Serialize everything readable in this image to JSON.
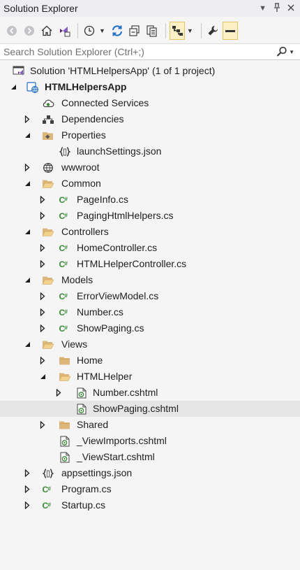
{
  "window": {
    "title": "Solution Explorer"
  },
  "search": {
    "placeholder": "Search Solution Explorer (Ctrl+;)"
  },
  "tree": [
    {
      "label": "Solution 'HTMLHelpersApp' (1 of 1 project)",
      "level": 0,
      "expander": "none",
      "icon": "solution-icon"
    },
    {
      "label": "HTMLHelpersApp",
      "level": 1,
      "expander": "expanded",
      "icon": "web-project-icon",
      "bold": true
    },
    {
      "label": "Connected Services",
      "level": 2,
      "expander": "none",
      "icon": "connected-services-icon"
    },
    {
      "label": "Dependencies",
      "level": 2,
      "expander": "collapsed",
      "icon": "dependencies-icon"
    },
    {
      "label": "Properties",
      "level": 2,
      "expander": "expanded",
      "icon": "properties-folder-icon"
    },
    {
      "label": "launchSettings.json",
      "level": 3,
      "expander": "none",
      "icon": "json-file-icon"
    },
    {
      "label": "wwwroot",
      "level": 2,
      "expander": "collapsed",
      "icon": "globe-icon"
    },
    {
      "label": "Common",
      "level": 2,
      "expander": "expanded",
      "icon": "folder-open-icon"
    },
    {
      "label": "PageInfo.cs",
      "level": 3,
      "expander": "collapsed",
      "icon": "csharp-file-icon"
    },
    {
      "label": "PagingHtmlHelpers.cs",
      "level": 3,
      "expander": "collapsed",
      "icon": "csharp-file-icon"
    },
    {
      "label": "Controllers",
      "level": 2,
      "expander": "expanded",
      "icon": "folder-open-icon"
    },
    {
      "label": "HomeController.cs",
      "level": 3,
      "expander": "collapsed",
      "icon": "csharp-file-icon"
    },
    {
      "label": "HTMLHelperController.cs",
      "level": 3,
      "expander": "collapsed",
      "icon": "csharp-file-icon"
    },
    {
      "label": "Models",
      "level": 2,
      "expander": "expanded",
      "icon": "folder-open-icon"
    },
    {
      "label": "ErrorViewModel.cs",
      "level": 3,
      "expander": "collapsed",
      "icon": "csharp-file-icon"
    },
    {
      "label": "Number.cs",
      "level": 3,
      "expander": "collapsed",
      "icon": "csharp-file-icon"
    },
    {
      "label": "ShowPaging.cs",
      "level": 3,
      "expander": "collapsed",
      "icon": "csharp-file-icon"
    },
    {
      "label": "Views",
      "level": 2,
      "expander": "expanded",
      "icon": "folder-open-icon"
    },
    {
      "label": "Home",
      "level": 3,
      "expander": "collapsed",
      "icon": "folder-icon"
    },
    {
      "label": "HTMLHelper",
      "level": 3,
      "expander": "expanded",
      "icon": "folder-open-icon"
    },
    {
      "label": "Number.cshtml",
      "level": 4,
      "expander": "collapsed",
      "icon": "cshtml-file-icon"
    },
    {
      "label": "ShowPaging.cshtml",
      "level": 4,
      "expander": "none",
      "icon": "cshtml-file-icon",
      "selected": true
    },
    {
      "label": "Shared",
      "level": 3,
      "expander": "collapsed",
      "icon": "folder-icon"
    },
    {
      "label": "_ViewImports.cshtml",
      "level": 3,
      "expander": "none",
      "icon": "cshtml-file-icon"
    },
    {
      "label": "_ViewStart.cshtml",
      "level": 3,
      "expander": "none",
      "icon": "cshtml-file-icon"
    },
    {
      "label": "appsettings.json",
      "level": 2,
      "expander": "collapsed",
      "icon": "json-file-icon"
    },
    {
      "label": "Program.cs",
      "level": 2,
      "expander": "collapsed",
      "icon": "csharp-file-icon"
    },
    {
      "label": "Startup.cs",
      "level": 2,
      "expander": "collapsed",
      "icon": "csharp-file-icon"
    }
  ],
  "colors": {
    "accent_blue": "#1e6fc8",
    "csharp_green": "#388a34",
    "folder_tan": "#dcb67a",
    "selection_bg": "#e6e6e6",
    "toolbar_selected_bg": "#fcf0c4"
  }
}
